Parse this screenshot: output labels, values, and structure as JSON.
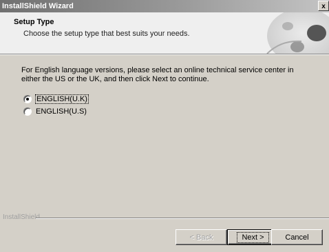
{
  "window": {
    "title": "InstallShield Wizard",
    "close_glyph": "x"
  },
  "header": {
    "title": "Setup Type",
    "subtitle": "Choose the setup type that best suits your needs."
  },
  "body": {
    "intro": "For English language versions, please select an online technical service center in either the US or the UK, and then click Next to continue.",
    "options": [
      {
        "label": "ENGLISH(U.K)",
        "selected": true
      },
      {
        "label": "ENGLISH(U.S)",
        "selected": false
      }
    ]
  },
  "footer": {
    "brand": "InstallShield",
    "back_label": "< Back",
    "next_label": "Next >",
    "cancel_label": "Cancel"
  }
}
